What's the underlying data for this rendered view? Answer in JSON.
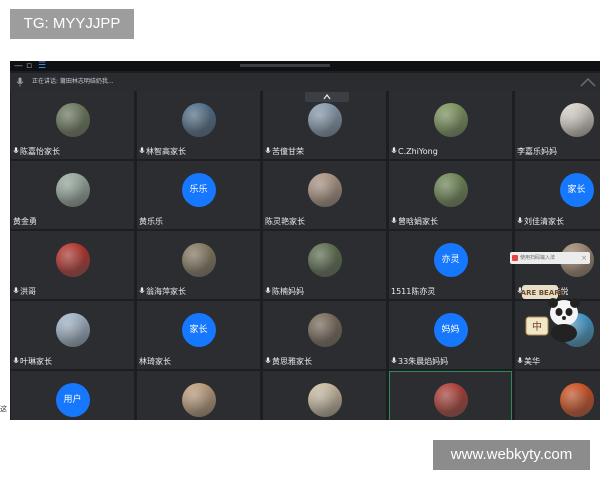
{
  "overlays": {
    "tg": "TG: MYYJJPP",
    "website": "www.webkyty.com",
    "side_text": "这"
  },
  "app": {
    "speaking_text": "正在讲话: 莆田林志明结奶我..."
  },
  "popup": {
    "text": "使用扫码输入法",
    "close": "×"
  },
  "sticker": {
    "text": "BARE BEARS",
    "label": "中"
  },
  "participants": [
    {
      "name": "陈嘉怡家长",
      "mic": true,
      "avatar": "photo",
      "color": "#6b7a5a"
    },
    {
      "name": "林智高家长",
      "mic": true,
      "avatar": "photo",
      "color": "#4b6e8c"
    },
    {
      "name": "苦僮甘荣",
      "mic": true,
      "avatar": "photo",
      "color": "#8aa0b6"
    },
    {
      "name": "C.ZhiYong",
      "mic": true,
      "avatar": "photo",
      "color": "#7c9a58"
    },
    {
      "name": "李嘉乐妈妈",
      "mic": false,
      "avatar": "photo",
      "color": "#e8e0d4"
    },
    {
      "name": "黄金勇",
      "mic": false,
      "avatar": "photo",
      "color": "#9fb3a6"
    },
    {
      "name": "黄乐乐",
      "mic": false,
      "avatar": "text",
      "text": "乐乐"
    },
    {
      "name": "陈灵艳家长",
      "mic": false,
      "avatar": "photo",
      "color": "#b59a86"
    },
    {
      "name": "曾晗娟家长",
      "mic": true,
      "avatar": "photo",
      "color": "#6e8a4f"
    },
    {
      "name": "刘佳清家长",
      "mic": true,
      "avatar": "text",
      "text": "家长"
    },
    {
      "name": "洪哥",
      "mic": true,
      "avatar": "photo",
      "color": "#c0281f"
    },
    {
      "name": "翁海萍家长",
      "mic": true,
      "avatar": "photo",
      "color": "#8a7a5e"
    },
    {
      "name": "陈楠妈妈",
      "mic": true,
      "avatar": "photo",
      "color": "#5a6e4a"
    },
    {
      "name": "1511陈亦灵",
      "mic": false,
      "avatar": "text",
      "text": "亦灵"
    },
    {
      "name": "1509陈佳悦",
      "mic": true,
      "avatar": "photo",
      "color": "#a88a70"
    },
    {
      "name": "叶琳家长",
      "mic": true,
      "avatar": "photo",
      "color": "#a9c0d6"
    },
    {
      "name": "林琦家长",
      "mic": false,
      "avatar": "text",
      "text": "家长"
    },
    {
      "name": "黄思雅家长",
      "mic": true,
      "avatar": "photo",
      "color": "#7a6a55"
    },
    {
      "name": "33朱晨焰妈妈",
      "mic": true,
      "avatar": "text",
      "text": "妈妈"
    },
    {
      "name": "美华",
      "mic": true,
      "avatar": "photo",
      "color": "#3aa0d8"
    },
    {
      "name": "",
      "mic": false,
      "avatar": "text",
      "text": "用户"
    },
    {
      "name": "",
      "mic": false,
      "avatar": "photo",
      "color": "#c8a37d"
    },
    {
      "name": "",
      "mic": false,
      "avatar": "photo",
      "color": "#d8c7a8"
    },
    {
      "name": "",
      "mic": false,
      "avatar": "photo",
      "color": "#b8342a",
      "active": true
    },
    {
      "name": "",
      "mic": false,
      "avatar": "photo",
      "color": "#e04a12"
    }
  ]
}
